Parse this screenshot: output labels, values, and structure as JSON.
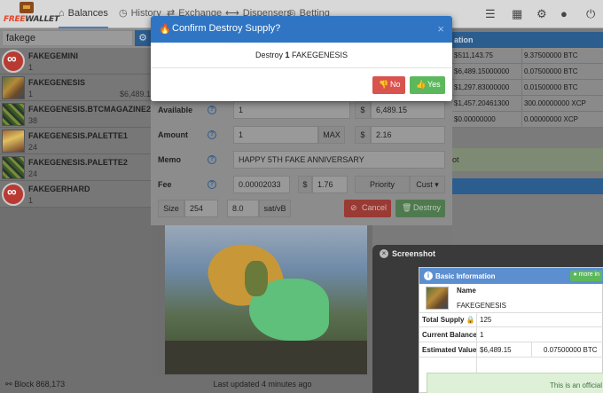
{
  "logo": {
    "part1": "FREE",
    "part2": "WALLET"
  },
  "nav": {
    "tabs": [
      "Balances",
      "History",
      "Exchange",
      "Dispensers",
      "Betting"
    ]
  },
  "sidebar": {
    "search_value": "fakege",
    "assets": [
      {
        "name": "FAKEGEMINI",
        "balance": "1",
        "value": ""
      },
      {
        "name": "FAKEGENESIS",
        "balance": "1",
        "value": "$6,489.1"
      },
      {
        "name": "FAKEGENESIS.BTCMAGAZINE22",
        "balance": "38",
        "value": ""
      },
      {
        "name": "FAKEGENESIS.PALETTE1",
        "balance": "24",
        "value": ""
      },
      {
        "name": "FAKEGENESIS.PALETTE2",
        "balance": "24",
        "value": ""
      },
      {
        "name": "FAKEGERHARD",
        "balance": "1",
        "value": ""
      }
    ],
    "block": "Block 868,173"
  },
  "footer": {
    "updated": "Last updated 4 minutes ago"
  },
  "right_table": {
    "header": "ation",
    "rows": [
      {
        "c1": "$511,143.75",
        "c2": "9.37500000 BTC"
      },
      {
        "c1": "$6,489.15000000",
        "c2": "0.07500000 BTC"
      },
      {
        "c1": "$1,297.83000000",
        "c2": "0.01500000 BTC"
      },
      {
        "c1": "$1,457.20461300",
        "c2": "300.00000000 XCP"
      },
      {
        "c1": "$0.00000000",
        "c2": "0.00000000 XCP"
      }
    ],
    "green_text": "ot"
  },
  "form": {
    "available_label": "Available",
    "available_value": "1",
    "available_usd_symbol": "$",
    "available_usd": "6,489.15",
    "amount_label": "Amount",
    "amount_value": "1",
    "max_label": "MAX",
    "amount_usd_symbol": "$",
    "amount_usd": "2.16",
    "memo_label": "Memo",
    "memo_value": "HAPPY 5TH FAKE ANNIVERSARY",
    "fee_label": "Fee",
    "fee_value": "0.00002033",
    "fee_usd_symbol": "$",
    "fee_usd": "1.76",
    "priority_label": "Priority",
    "custom_label": "Cust",
    "size_label": "Size",
    "size_value": "254",
    "rate_value": "8.0",
    "rate_unit": "sat/vB",
    "cancel_label": "Cancel",
    "destroy_label": "Destroy"
  },
  "modal": {
    "title": "Confirm Destroy Supply?",
    "message_pre": "Destroy",
    "message_amount": "1",
    "message_asset": "FAKEGENESIS",
    "no_label": "No",
    "yes_label": "Yes"
  },
  "screenshot_window": {
    "title": "Screenshot",
    "panel_title": "Basic Information",
    "more_info": "more in",
    "name_label": "Name",
    "name_value": "FAKEGENESIS",
    "total_supply_label": "Total Supply",
    "total_supply_value": "125",
    "current_balance_label": "Current Balance",
    "current_balance_value": "1",
    "estimated_value_label": "Estimated Value",
    "estimated_usd": "$6,489.15",
    "estimated_btc": "0.07500000 BTC",
    "official_text": "This is an official"
  },
  "colors": {
    "modal_header": "#2f75c4",
    "no_button": "#d9534f",
    "yes_button": "#5cb85c",
    "nav_accent": "#2c5d8f"
  }
}
